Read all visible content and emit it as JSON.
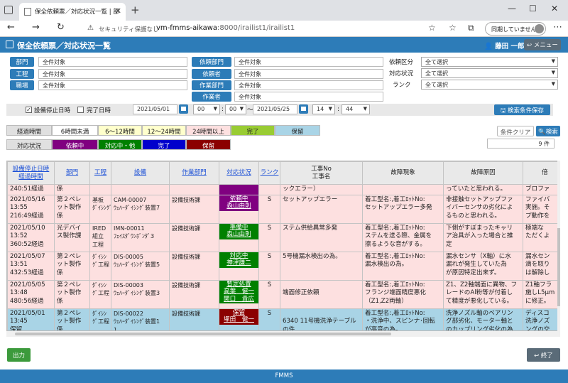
{
  "browser": {
    "tab_title": "保全依頼票／対応状況一覧 | 部",
    "security_label": "セキュリティ保護なし",
    "url_host": "vm-fmms-aikawa",
    "url_path": ":8000/irailist1/irailist1",
    "sync_label": "同期していません"
  },
  "header": {
    "title": "保全依頼票／対応状況一覧",
    "user": "藤田 一郎",
    "menu_label": "メニュー"
  },
  "filters": {
    "bumon_label": "部門",
    "bumon_value": "全件対象",
    "koutei_label": "工程",
    "koutei_value": "全件対象",
    "shokuba_label": "職場",
    "shokuba_value": "全件対象",
    "irai_bumon_label": "依頼部門",
    "irai_bumon_value": "全件対象",
    "iraisha_label": "依頼者",
    "iraisha_value": "全件対象",
    "sagyo_bumon_label": "作業部門",
    "sagyo_bumon_value": "全件対象",
    "sagyosha_label": "作業者",
    "sagyosha_value": "全件対象",
    "irai_kubun_label": "依頼区分",
    "irai_kubun_value": "全て選択",
    "taiou_label": "対応状況",
    "taiou_value": "全て選択",
    "rank_label": "ランク",
    "rank_value": "全て選択"
  },
  "dates": {
    "chk1_label": "設備停止日時",
    "chk2_label": "完了日時",
    "from_date": "2021/05/01",
    "from_hour": "00",
    "from_min": "00",
    "tilde": "〜",
    "to_date": "2021/05/25",
    "to_hour": "14",
    "to_min": "44",
    "colon": ":",
    "save_label": "検索条件保存"
  },
  "legend": {
    "elapsed_label": "経過時間",
    "e1": "6時間未満",
    "e2": "6〜12時間",
    "e3": "12〜24時間",
    "e4": "24時間以上",
    "e5": "完了",
    "e6": "保留",
    "status_label": "対応状況",
    "s1": "依頼中",
    "s2": "対応中・他",
    "s3": "完了",
    "s4": "保留",
    "colors": {
      "e2": "#ffffcc",
      "e3": "#ffffcc",
      "e4": "#fde0e0",
      "e5": "#99cc33",
      "e6": "#a9d4e6",
      "s1": "#800080",
      "s2": "#008000",
      "s3": "#0000cc",
      "s4": "#8b0000"
    }
  },
  "actions": {
    "clear_label": "条件クリア",
    "search_label": "検索",
    "count": "9 件",
    "output_label": "出力",
    "end_label": "終了"
  },
  "table": {
    "headers": {
      "h1a": "設備停止日時",
      "h1b": "経過時間",
      "h2": "部門",
      "h3": "工程",
      "h4": "設備",
      "h5": "作業部門",
      "h6": "対応状況",
      "h7": "ランク",
      "h8a": "工事No",
      "h8b": "工事名",
      "h9": "故障現象",
      "h10": "故障原因",
      "h11": "倍"
    },
    "rows": [
      {
        "c1": [
          "240:51経過"
        ],
        "c2": [
          "係"
        ],
        "c3": [
          ""
        ],
        "c4": [
          ""
        ],
        "c5": "",
        "status": [
          ""
        ],
        "rank": "",
        "c8": [
          "ックエラー）"
        ],
        "c9": [
          ""
        ],
        "c10": [
          "っていたと思われる。"
        ],
        "c11": [
          "ブロファ"
        ]
      },
      {
        "c1": [
          "2021/05/16",
          "13:55",
          "216:49経過"
        ],
        "c2": [
          "第２ペレ",
          "ット製作",
          "係"
        ],
        "c3": [
          "基板",
          "ﾀﾞｲｼﾝｸﾞ"
        ],
        "c4": [
          "CAM-00007",
          "ｳｪﾊｰﾀﾞｲｼﾝｸﾞ装置7"
        ],
        "c5": "設備技術課",
        "status": [
          "依頼中",
          "森山由則"
        ],
        "rank": "S",
        "c8": [
          "セットアップエラー"
        ],
        "c9": [
          "着工型名:,着工ﾛｯﾄNo:",
          "セットアップエラー多発"
        ],
        "c10": [
          "非接触セットアップファ",
          "イバーセンサの劣化によ",
          "るものと思われる。"
        ],
        "c11": [
          "ファイバ",
          "実施。そ",
          "プ動作を"
        ]
      },
      {
        "c1": [
          "2021/05/10",
          "13:52",
          "360:52経過"
        ],
        "c2": [
          "光デバイ",
          "ス製作課"
        ],
        "c3": [
          "IRED",
          "組立",
          "工程"
        ],
        "c4": [
          "IMN-00011",
          "ﾌｪｲｽﾀﾞｳﾝﾎﾞﾝﾀﾞ3"
        ],
        "c5": "設備技術課",
        "status": [
          "準備中",
          "森山由則"
        ],
        "rank": "S",
        "c8": [
          "ステム供給異常多発"
        ],
        "c9": [
          "着工型名:,着工ﾛｯﾄNo:",
          "ステムを送る際、金属を",
          "擦るような音がする。"
        ],
        "c10": [
          "下側がすぼまったキャリ",
          "ア治具が入った場合と推",
          "定"
        ],
        "c11": [
          "極端な",
          "ただくよ"
        ]
      },
      {
        "c1": [
          "2021/05/07",
          "13:51",
          "432:53経過"
        ],
        "c2": [
          "第２ペレ",
          "ット製作",
          "係"
        ],
        "c3": [
          "ﾀﾞｲｼﾝ",
          "ｸﾞ工程"
        ],
        "c4": [
          "DIS-00005",
          "ｳｪﾊｰﾀﾞｲｼﾝｸﾞ装置5"
        ],
        "c5": "設備技術課",
        "status": [
          "対応中",
          "神津謙二"
        ],
        "rank": "S",
        "c8": [
          "5号機漏水検出の為。"
        ],
        "c9": [
          "着工型名:,着工ﾛｯﾄNo:",
          "漏水検出の為。"
        ],
        "c10": [
          "漏水センサ（X軸）に水",
          "漏れが発生していた為",
          "が原因特定出来ず。"
        ],
        "c11": [
          "漏水セン",
          "滴を取り",
          "は解除し"
        ]
      },
      {
        "c1": [
          "2021/05/05",
          "13:48",
          "480:56経過"
        ],
        "c2": [
          "第２ペレ",
          "ット製作",
          "係"
        ],
        "c3": [
          "ﾀﾞｲｼﾝ",
          "ｸﾞ工程"
        ],
        "c4": [
          "DIS-00003",
          "ｳｪﾊｰﾀﾞｲｼﾝｸﾞ装置3"
        ],
        "c5": "設備技術課",
        "status": [
          "暫定処置",
          "高葉　健一",
          "関口　貴広"
        ],
        "rank": "S",
        "c8": [
          "",
          "端面修正依頼"
        ],
        "c9": [
          "着工型名:,着工ﾛｯﾄNo:",
          "フランジ端面精度悪化",
          "（Z1,Z2両軸）"
        ],
        "c10": [
          "Z1、Z2軸端面に異物、フ",
          "レードのAl粉等が付着し",
          "て精度が悪化している。"
        ],
        "c11": [
          "Z1軸フラ",
          "施しL5μm",
          "に修正。"
        ]
      },
      {
        "c1": [
          "2021/05/01",
          "13:45",
          "保留"
        ],
        "c2": [
          "第２ペレ",
          "ット製作",
          "係"
        ],
        "c3": [
          "ﾀﾞｲｼﾝ",
          "ｸﾞ工程"
        ],
        "c4": [
          "DIS-00022",
          "ｳｪﾊｰﾀﾞｲｼﾝｸﾞ装置1",
          "1"
        ],
        "c5": "設備技術課",
        "status": [
          "保留",
          "塚田　健一"
        ],
        "rank": "S",
        "c8": [
          "",
          "6340 11号機洗浄テーブル",
          "の件"
        ],
        "c9": [
          "着工型名:,着工ﾛｯﾄNo:",
          "・洗浄中、スピンナ･回転",
          "が高音の為。"
        ],
        "c10": [
          "洗浄ノズル軸のベアリン",
          "グ部劣化、モーター軸と",
          "のカップリング劣化の為"
        ],
        "c11": [
          "ディスコ",
          "洗浄ノズ",
          "ングの交"
        ]
      }
    ]
  }
}
